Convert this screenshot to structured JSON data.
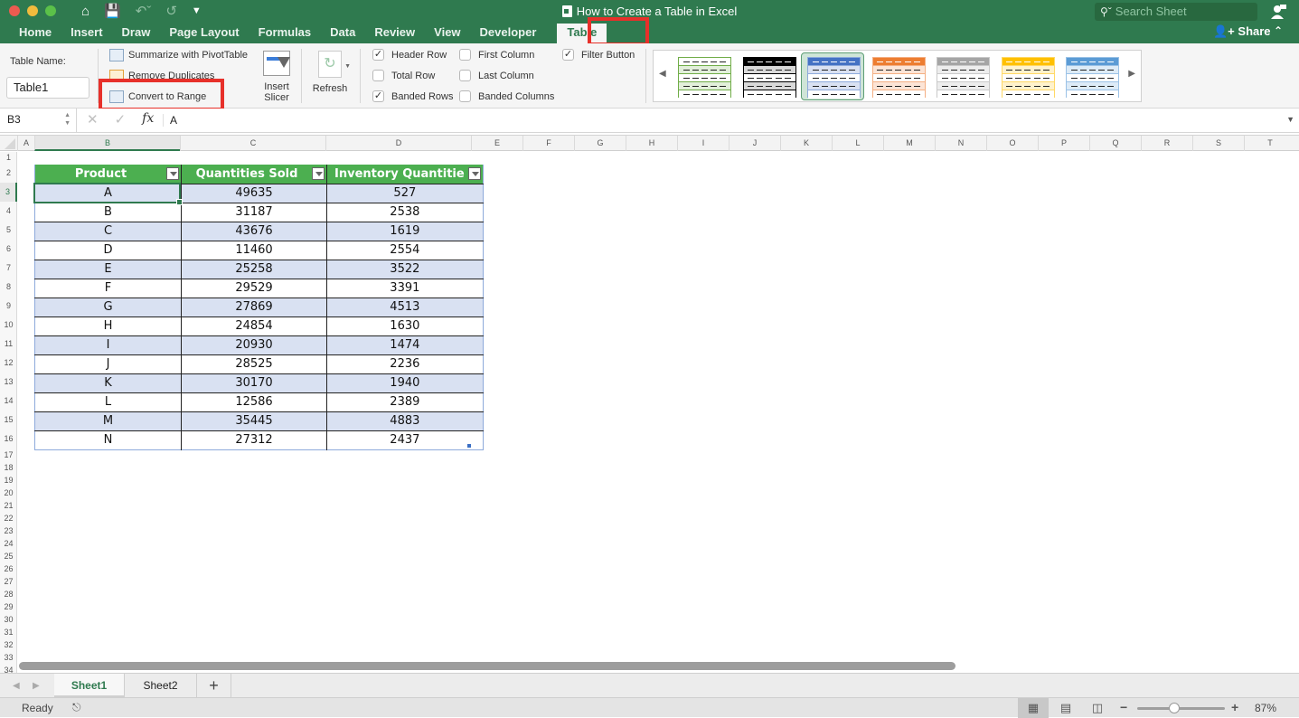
{
  "window": {
    "title": "How to Create a Table in Excel",
    "search_placeholder": "Search Sheet",
    "share_label": "Share"
  },
  "ribbon_tabs": [
    {
      "label": "Home",
      "active": false
    },
    {
      "label": "Insert",
      "active": false
    },
    {
      "label": "Draw",
      "active": false
    },
    {
      "label": "Page Layout",
      "active": false
    },
    {
      "label": "Formulas",
      "active": false
    },
    {
      "label": "Data",
      "active": false
    },
    {
      "label": "Review",
      "active": false
    },
    {
      "label": "View",
      "active": false
    },
    {
      "label": "Developer",
      "active": false
    },
    {
      "label": "Table",
      "active": true
    }
  ],
  "ribbon": {
    "table_name_label": "Table Name:",
    "table_name_value": "Table1",
    "tools": {
      "summarize": "Summarize with PivotTable",
      "remove_duplicates": "Remove Duplicates",
      "convert_to_range": "Convert to Range"
    },
    "insert_slicer": "Insert Slicer",
    "refresh": "Refresh",
    "style_options": [
      {
        "label": "Header Row",
        "checked": true
      },
      {
        "label": "Total Row",
        "checked": false
      },
      {
        "label": "Banded Rows",
        "checked": true
      },
      {
        "label": "First Column",
        "checked": false
      },
      {
        "label": "Last Column",
        "checked": false
      },
      {
        "label": "Banded Columns",
        "checked": false
      },
      {
        "label": "Filter Button",
        "checked": true
      }
    ],
    "table_styles": [
      {
        "name": "green-grid",
        "header": "#ffffff",
        "band": "#e2efda",
        "border": "#70ad47"
      },
      {
        "name": "black",
        "header": "#000000",
        "band": "#d9d9d9",
        "border": "#000000"
      },
      {
        "name": "blue-medium",
        "header": "#4472c4",
        "band": "#d9e1f2",
        "border": "#8eaadb",
        "selected": true
      },
      {
        "name": "orange-medium",
        "header": "#ed7d31",
        "band": "#fce4d6",
        "border": "#f4b084"
      },
      {
        "name": "gray-medium",
        "header": "#a5a5a5",
        "band": "#ededed",
        "border": "#c9c9c9"
      },
      {
        "name": "gold-medium",
        "header": "#ffc000",
        "band": "#fff2cc",
        "border": "#ffd966"
      },
      {
        "name": "lightblue-medium",
        "header": "#5b9bd5",
        "band": "#ddebf7",
        "border": "#9bc2e6"
      }
    ]
  },
  "formula_bar": {
    "name_box": "B3",
    "formula": "A",
    "fx_label": "fx"
  },
  "columns": [
    "A",
    "B",
    "C",
    "D",
    "E",
    "F",
    "G",
    "H",
    "I",
    "J",
    "K",
    "L",
    "M",
    "N",
    "O",
    "P",
    "Q",
    "R",
    "S",
    "T"
  ],
  "selected_column": "B",
  "selected_row": 3,
  "row_numbers": [
    1,
    2,
    3,
    4,
    5,
    6,
    7,
    8,
    9,
    10,
    11,
    12,
    13,
    14,
    15,
    16,
    17,
    18,
    19,
    20,
    21,
    22,
    23,
    24,
    25,
    26,
    27,
    28,
    29,
    30,
    31,
    32,
    33,
    34
  ],
  "table": {
    "headers": [
      "Product",
      "Quantities Sold",
      "Inventory Quantitie"
    ],
    "rows": [
      [
        "A",
        "49635",
        "527"
      ],
      [
        "B",
        "31187",
        "2538"
      ],
      [
        "C",
        "43676",
        "1619"
      ],
      [
        "D",
        "11460",
        "2554"
      ],
      [
        "E",
        "25258",
        "3522"
      ],
      [
        "F",
        "29529",
        "3391"
      ],
      [
        "G",
        "27869",
        "4513"
      ],
      [
        "H",
        "24854",
        "1630"
      ],
      [
        "I",
        "20930",
        "1474"
      ],
      [
        "J",
        "28525",
        "2236"
      ],
      [
        "K",
        "30170",
        "1940"
      ],
      [
        "L",
        "12586",
        "2389"
      ],
      [
        "M",
        "35445",
        "4883"
      ],
      [
        "N",
        "27312",
        "2437"
      ]
    ],
    "header_color": "#4caf50",
    "band_color": "#d9e1f2"
  },
  "sheets": [
    {
      "label": "Sheet1",
      "active": true
    },
    {
      "label": "Sheet2",
      "active": false
    }
  ],
  "add_sheet_label": "+",
  "status": {
    "ready": "Ready",
    "zoom": "87%",
    "zoom_percent": 87
  },
  "highlight_color": "#e7302a"
}
